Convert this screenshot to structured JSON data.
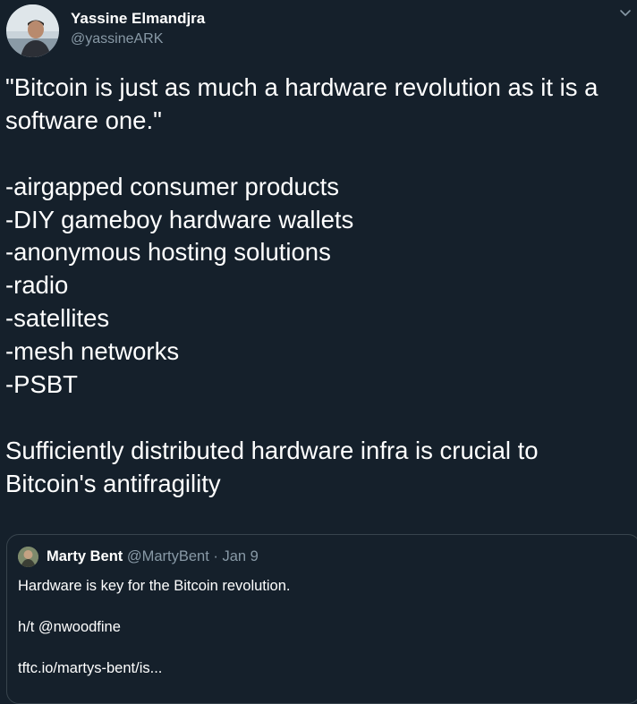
{
  "tweet": {
    "author": {
      "name": "Yassine Elmandjra",
      "handle": "@yassineARK"
    },
    "body": {
      "lines": [
        "\"Bitcoin is just as much a hardware revolution as it is a",
        "software one.\"",
        "-airgapped consumer products",
        "-DIY gameboy hardware wallets",
        "-anonymous hosting solutions",
        "-radio",
        "-satellites",
        "-mesh networks",
        "-PSBT",
        "Sufficiently distributed hardware infra is crucial to",
        "Bitcoin's antifragility"
      ]
    },
    "menu_icon": "chevron-down-icon",
    "quoted": {
      "name": "Marty Bent",
      "handle": "@MartyBent",
      "separator": "·",
      "date": "Jan 9",
      "lines": [
        "Hardware is key for the Bitcoin revolution.",
        "h/t @nwoodfine",
        "tftc.io/martys-bent/is..."
      ]
    }
  },
  "colors": {
    "background": "#15202b",
    "text": "#ffffff",
    "secondary_text": "#8899a6",
    "border": "#38444d"
  }
}
